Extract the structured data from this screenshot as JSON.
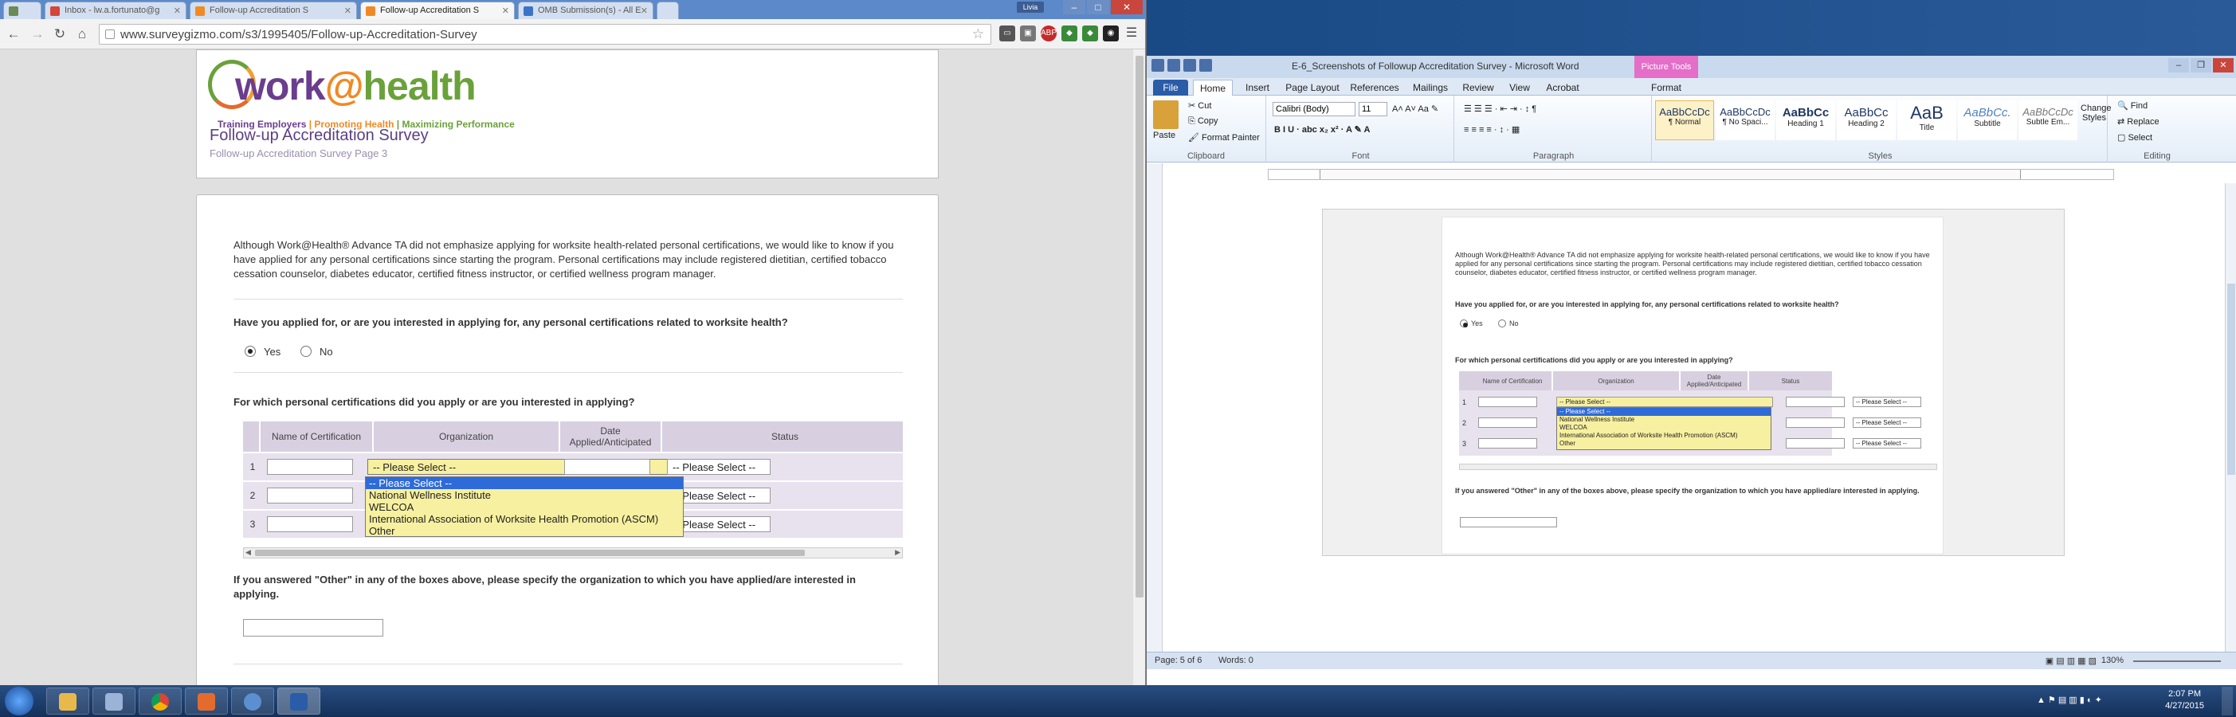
{
  "browser": {
    "tabs": [
      {
        "label": "",
        "color": "#6a8a58"
      },
      {
        "label": "Inbox - lw.a.fortunato@g",
        "color": "#d44638"
      },
      {
        "label": "Follow-up Accreditation S",
        "color": "#f08a24"
      },
      {
        "label": "Follow-up Accreditation S",
        "color": "#f08a24"
      },
      {
        "label": "OMB Submission(s) - All E",
        "color": "#3a74c8"
      }
    ],
    "user": "Livia",
    "url": "www.surveygizmo.com/s3/1995405/Follow-up-Accreditation-Survey",
    "ext_abp": "ABP"
  },
  "survey": {
    "logo_work": "work",
    "logo_at": "@",
    "logo_health": "health",
    "tag1": "Training Employers",
    "tag_sep1": " | ",
    "tag2": "Promoting Health",
    "tag_sep2": " | ",
    "tag3": "Maximizing Performance",
    "title": "Follow-up Accreditation Survey",
    "page": "Follow-up Accreditation Survey Page 3",
    "intro": "Although Work@Health® Advance TA did not emphasize applying for worksite health-related personal certifications, we would like to know if you have applied for any personal certifications since starting the program. Personal certifications may include registered dietitian, certified tobacco cessation counselor, diabetes educator, certified fitness instructor, or certified wellness program manager.",
    "q1": "Have you applied for, or are you interested in applying for, any personal certifications related to worksite health?",
    "yes": "Yes",
    "no": "No",
    "q2": "For which personal certifications did you apply or are you interested in applying?",
    "col_name": "Name of Certification",
    "col_org": "Organization",
    "col_date": "Date Applied/Anticipated",
    "col_status": "Status",
    "rows": [
      "1",
      "2",
      "3"
    ],
    "select_placeholder": "-- Please Select --",
    "options": [
      "-- Please Select --",
      "National Wellness Institute",
      "WELCOA",
      "International Association of Worksite Health Promotion (ASCM)",
      "Other"
    ],
    "q3": "If you answered \"Other\" in any of the boxes above, please specify the organization to which you have applied/are interested in applying."
  },
  "word": {
    "title": "E-6_Screenshots of Followup Accreditation Survey - Microsoft Word",
    "picture_tools": "Picture Tools",
    "tabs": [
      "File",
      "Home",
      "Insert",
      "Page Layout",
      "References",
      "Mailings",
      "Review",
      "View",
      "Acrobat",
      "Format"
    ],
    "clipboard": {
      "paste": "Paste",
      "cut": "Cut",
      "copy": "Copy",
      "painter": "Format Painter",
      "label": "Clipboard"
    },
    "font": {
      "name": "Calibri (Body)",
      "size": "11",
      "label": "Font"
    },
    "paragraph_label": "Paragraph",
    "styles": [
      {
        "preview": "AaBbCcDc",
        "name": "¶ Normal"
      },
      {
        "preview": "AaBbCcDc",
        "name": "¶ No Spaci..."
      },
      {
        "preview": "AaBbCc",
        "name": "Heading 1"
      },
      {
        "preview": "AaBbCc",
        "name": "Heading 2"
      },
      {
        "preview": "AaB",
        "name": "Title"
      },
      {
        "preview": "AaBbCc.",
        "name": "Subtitle"
      },
      {
        "preview": "AaBbCcDc",
        "name": "Subtle Em..."
      }
    ],
    "change_styles": "Change Styles",
    "styles_label": "Styles",
    "editing": {
      "find": "Find",
      "replace": "Replace",
      "select": "Select",
      "label": "Editing"
    },
    "status_page": "Page: 5 of 6",
    "status_words": "Words: 0",
    "zoom": "130%"
  },
  "taskbar": {
    "time": "2:07 PM",
    "date": "4/27/2015"
  }
}
